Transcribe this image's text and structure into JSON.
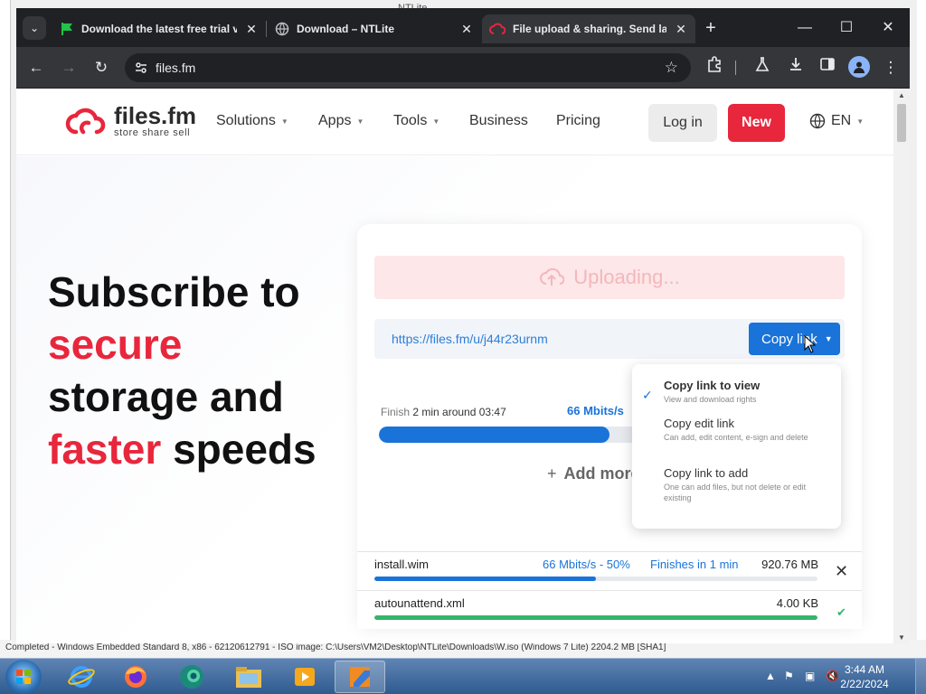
{
  "desktop": {
    "title": "NTLite",
    "status_text": "Completed - Windows Embedded Standard 8, x86 - 62120612791 - ISO image: C:\\Users\\VM2\\Desktop\\NTLite\\Downloads\\W.iso (Windows 7 Lite) 2204.2 MB [SHA1]"
  },
  "browser": {
    "tabs": [
      {
        "label": "Download the latest free trial v",
        "icon": "green-flag-icon",
        "active": false
      },
      {
        "label": "Download – NTLite",
        "icon": "globe-icon",
        "active": false
      },
      {
        "label": "File upload & sharing. Send lar",
        "icon": "files-fm-cloud-icon",
        "active": true
      }
    ],
    "new_tab": "+",
    "url": "files.fm"
  },
  "site": {
    "logo_name": "files.fm",
    "logo_tagline": "store share sell",
    "nav": [
      {
        "label": "Solutions",
        "dropdown": true
      },
      {
        "label": "Apps",
        "dropdown": true
      },
      {
        "label": "Tools",
        "dropdown": true
      },
      {
        "label": "Business",
        "dropdown": false
      },
      {
        "label": "Pricing",
        "dropdown": false
      }
    ],
    "login_label": "Log in",
    "new_label": "New",
    "language": "EN",
    "headline": {
      "line1": "Subscribe to",
      "line2": "secure",
      "line3": "storage and",
      "line4_red": "faster",
      "line4_rest": " speeds"
    }
  },
  "upload": {
    "status": "Uploading...",
    "link": "https://files.fm/u/j44r23urnm",
    "copy_button": "Copy link",
    "finish_prefix": "Finish",
    "finish_value": "2 min around 03:47",
    "speed": "66 Mbits/s",
    "progress": 0.5,
    "add_more": "Add more",
    "dropdown": [
      {
        "title": "Copy link to view",
        "subtitle": "View and download rights",
        "checked": true
      },
      {
        "title": "Copy edit link",
        "subtitle": "Can add, edit content, e-sign and delete",
        "checked": false
      },
      {
        "title": "Copy link to add",
        "subtitle": "One can add files, but not delete or edit existing",
        "checked": false
      }
    ],
    "files": [
      {
        "name": "install.wim",
        "speed_pct": "66 Mbits/s - 50%",
        "eta": "Finishes in 1 min",
        "size": "920.76 MB",
        "progress": 0.5,
        "done": false
      },
      {
        "name": "autounattend.xml",
        "speed_pct": "",
        "eta": "",
        "size": "4.00 KB",
        "progress": 1.0,
        "done": true
      }
    ],
    "colors": {
      "accent": "#1973d9",
      "brand_red": "#e8263c",
      "done_green": "#35b56a"
    }
  },
  "taskbar": {
    "time": "3:44 AM",
    "date": "2/22/2024",
    "apps": [
      "internet-explorer-icon",
      "firefox-icon",
      "edge-icon",
      "file-explorer-icon",
      "media-player-icon",
      "ntlite-icon"
    ]
  }
}
